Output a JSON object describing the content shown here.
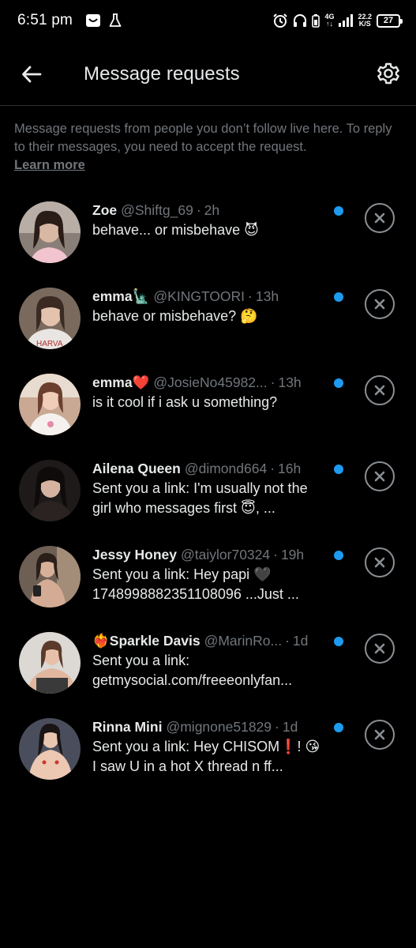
{
  "status_bar": {
    "time": "6:51 pm",
    "network": "4G",
    "speed_value": "22.2",
    "speed_unit": "K/S",
    "battery": "27"
  },
  "header": {
    "title": "Message requests",
    "back_icon": "arrow-left-icon",
    "settings_icon": "gear-icon"
  },
  "info": {
    "text": "Message requests from people you don’t follow live here. To reply to their messages, you need to accept the request.",
    "link": "Learn more"
  },
  "colors": {
    "background": "#000000",
    "accent": "#1d9bf0",
    "secondary_text": "#71767b",
    "primary_text": "#e7e9ea"
  },
  "requests": [
    {
      "name": "Zoe",
      "handle": "@Shiftg_69",
      "time": "2h",
      "message": "behave... or misbehave 😈",
      "unread": true
    },
    {
      "name": "emma🗽",
      "handle": "@KINGTOORI",
      "time": "13h",
      "message": "behave or misbehave? 🤔",
      "unread": true
    },
    {
      "name": "emma❤️",
      "handle": "@JosieNo45982...",
      "time": "13h",
      "message": "is it cool if i ask u something?",
      "unread": true
    },
    {
      "name": "Ailena Queen",
      "handle": "@dimond664",
      "time": "16h",
      "message": "Sent you a link: I'm usually not the girl who messages first 😇, ...",
      "unread": true
    },
    {
      "name": "Jessy Honey",
      "handle": "@taiylor70324",
      "time": "19h",
      "message": "Sent you a link: Hey papi 🖤 1748998882351108096 ...Just ...",
      "unread": true
    },
    {
      "name": "❤️‍🔥Sparkle Davis",
      "handle": "@MarinRo...",
      "time": "1d",
      "message": "Sent you a link: getmysocial.com/freeeonlyfan...",
      "unread": true
    },
    {
      "name": "Rinna Mini",
      "handle": "@mignone51829",
      "time": "1d",
      "message": "Sent you a link: Hey CHISOM❗! 😘 I saw U in a hot X thread n ff...",
      "unread": true
    }
  ]
}
